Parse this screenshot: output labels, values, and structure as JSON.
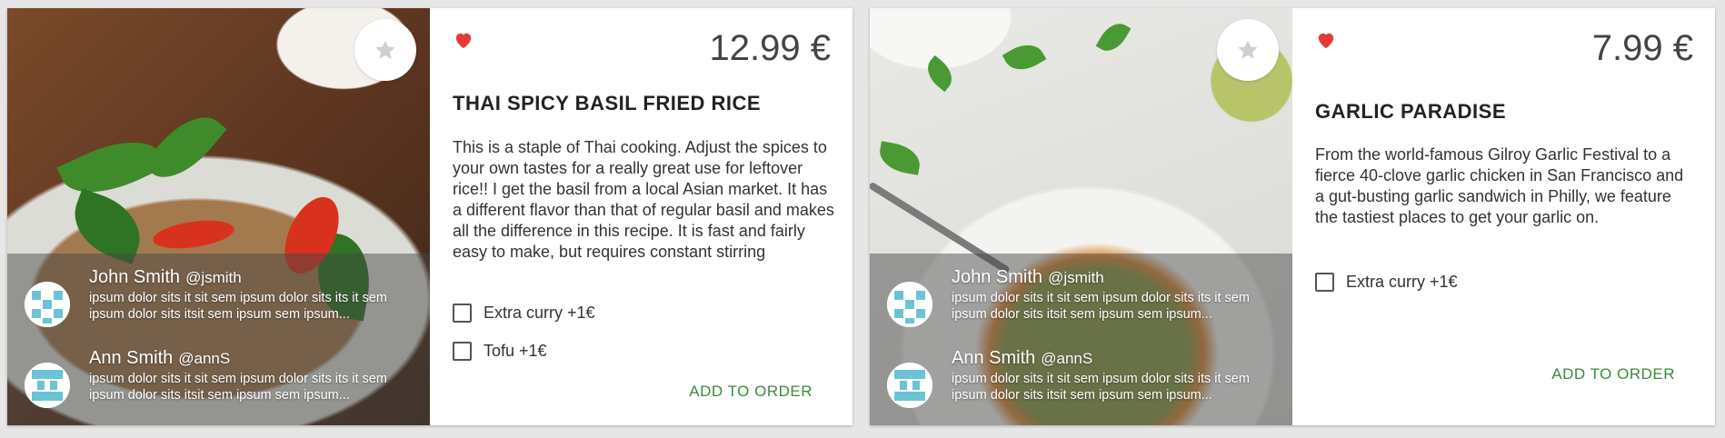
{
  "cards": [
    {
      "price": "12.99 €",
      "title": "THAI SPICY BASIL FRIED RICE",
      "description": "This is a staple of Thai cooking. Adjust the spices to your own tastes for a really great use for leftover rice!! I get the basil from a local Asian market. It has a different flavor than that of regular basil and makes all the difference in this recipe. It is fast and fairly easy to make, but requires constant stirring",
      "options": [
        "Extra curry +1€",
        "Tofu +1€"
      ],
      "order_label": "ADD TO ORDER",
      "reviews": [
        {
          "name": "John Smith",
          "handle": "@jsmith",
          "text": "ipsum dolor sits it sit sem ipsum dolor sits its it sem ipsum dolor sits itsit sem ipsum sem ipsum..."
        },
        {
          "name": "Ann Smith",
          "handle": "@annS",
          "text": "ipsum dolor sits it sit sem ipsum dolor sits its it sem ipsum dolor sits itsit sem ipsum sem ipsum..."
        }
      ]
    },
    {
      "price": "7.99 €",
      "title": "GARLIC PARADISE",
      "description": "From the world-famous Gilroy Garlic Festival to a fierce 40-clove garlic chicken in San Francisco and a gut-busting garlic sandwich in Philly, we feature the tastiest places to get your garlic on.",
      "options": [
        "Extra curry +1€"
      ],
      "order_label": "ADD TO ORDER",
      "reviews": [
        {
          "name": "John Smith",
          "handle": "@jsmith",
          "text": "ipsum dolor sits it sit sem ipsum dolor sits its it sem ipsum dolor sits itsit sem ipsum sem ipsum..."
        },
        {
          "name": "Ann Smith",
          "handle": "@annS",
          "text": "ipsum dolor sits it sit sem ipsum dolor sits its it sem ipsum dolor sits itsit sem ipsum sem ipsum..."
        }
      ]
    }
  ],
  "icons": {
    "favorite": "star-icon",
    "liked": "heart-icon",
    "avatar": "identicon-avatar"
  },
  "colors": {
    "heart": "#e53935",
    "star": "#cfcfcf",
    "order_text": "#3b8a3b",
    "avatar": "#6cc3d5"
  }
}
